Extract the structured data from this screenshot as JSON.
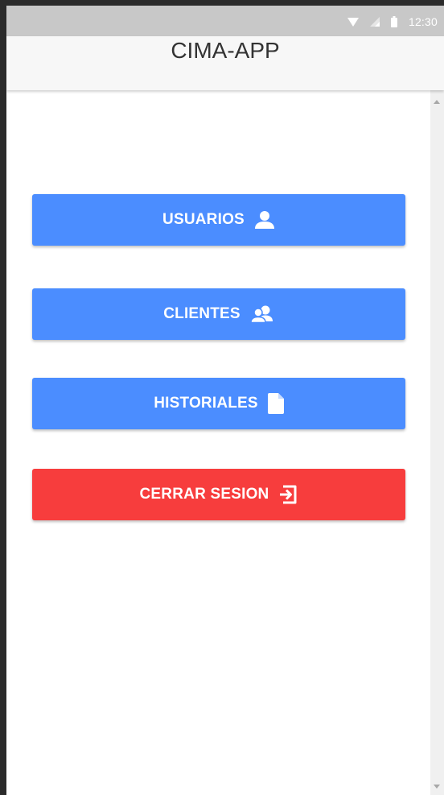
{
  "status_bar": {
    "time": "12:30",
    "icons": [
      "wifi-icon",
      "signal-icon",
      "battery-icon"
    ]
  },
  "app_bar": {
    "title": "CIMA-APP"
  },
  "menu": {
    "buttons": [
      {
        "label": "USUARIOS",
        "icon": "user-icon",
        "color": "#4b8dff"
      },
      {
        "label": "CLIENTES",
        "icon": "users-group-icon",
        "color": "#4b8dff"
      },
      {
        "label": "HISTORIALES",
        "icon": "document-icon",
        "color": "#4b8dff"
      },
      {
        "label": "CERRAR SESION",
        "icon": "logout-icon",
        "color": "#f73d3d"
      }
    ]
  }
}
